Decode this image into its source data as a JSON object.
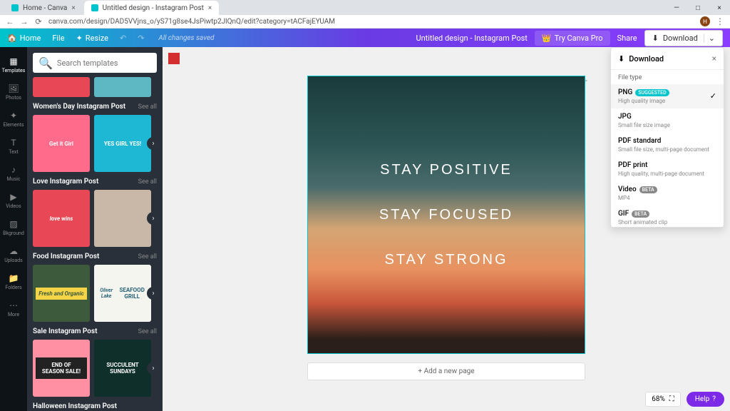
{
  "browser": {
    "tabs": [
      {
        "title": "Home - Canva"
      },
      {
        "title": "Untitled design - Instagram Post"
      }
    ],
    "url": "canva.com/design/DAD5VVjns_o/yS71g8se4JsPiwtp2JlQnQ/edit?category=tACFajEYUAM"
  },
  "topbar": {
    "home": "Home",
    "file": "File",
    "resize": "Resize",
    "status": "All changes saved",
    "doc_title": "Untitled design - Instagram Post",
    "try_pro": "Try Canva Pro",
    "share": "Share",
    "download": "Download"
  },
  "rail": [
    {
      "label": "Templates"
    },
    {
      "label": "Photos"
    },
    {
      "label": "Elements"
    },
    {
      "label": "Text"
    },
    {
      "label": "Music"
    },
    {
      "label": "Videos"
    },
    {
      "label": "Bkground"
    },
    {
      "label": "Uploads"
    },
    {
      "label": "Folders"
    },
    {
      "label": "More"
    }
  ],
  "search": {
    "placeholder": "Search templates"
  },
  "sections": [
    {
      "title": "Women's Day Instagram Post",
      "see_all": "See all",
      "cards": [
        {
          "text": "Get it Girl",
          "bg": "#ff6b8a"
        },
        {
          "text": "YES GIRL YES!",
          "bg": "#1fb8d4"
        }
      ]
    },
    {
      "title": "Love Instagram Post",
      "see_all": "See all",
      "cards": [
        {
          "text": "love wins",
          "bg": "#e84855"
        },
        {
          "text": "",
          "bg": "#c9b8a8"
        }
      ]
    },
    {
      "title": "Food Instagram Post",
      "see_all": "See all",
      "cards": [
        {
          "text": "Fresh and Organic",
          "bg": "#3d5a3d"
        },
        {
          "text": "SEAFOOD GRILL",
          "bg": "#f5f5f0"
        }
      ]
    },
    {
      "title": "Sale Instagram Post",
      "see_all": "See all",
      "cards": [
        {
          "text": "END OF SEASON SALE!",
          "bg": "#ff8fa3"
        },
        {
          "text": "SUCCULENT SUNDAYS",
          "bg": "#0f2f2a"
        }
      ]
    },
    {
      "title": "Halloween Instagram Post",
      "see_all": "See all",
      "cards": []
    }
  ],
  "canvas": {
    "line1": "STAY POSITIVE",
    "line2": "STAY FOCUSED",
    "line3": "STAY STRONG",
    "add_page": "+ Add a new page"
  },
  "download_panel": {
    "title": "Download",
    "file_type_label": "File type",
    "options": [
      {
        "name": "PNG",
        "badge": "SUGGESTED",
        "desc": "High quality image",
        "selected": true
      },
      {
        "name": "JPG",
        "badge": "",
        "desc": "Small file size image"
      },
      {
        "name": "PDF standard",
        "badge": "",
        "desc": "Small file size, multi-page document"
      },
      {
        "name": "PDF print",
        "badge": "",
        "desc": "High quality, multi-page document"
      },
      {
        "name": "Video",
        "badge": "BETA",
        "desc": "MP4"
      },
      {
        "name": "GIF",
        "badge": "BETA",
        "desc": "Short animated clip"
      }
    ]
  },
  "zoom": "68%",
  "help": "Help"
}
